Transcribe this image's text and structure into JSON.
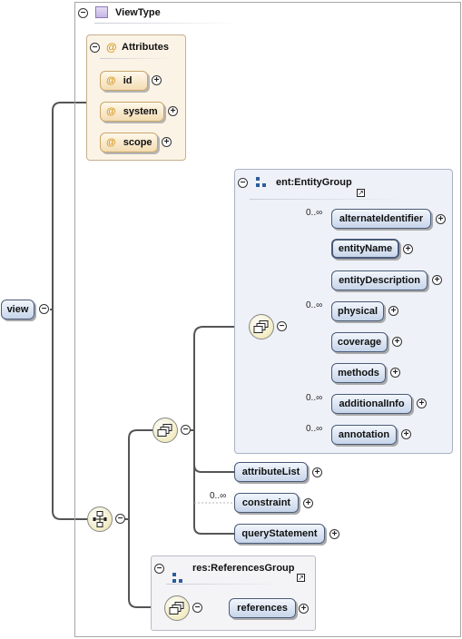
{
  "root": {
    "title": "ViewType",
    "element": "view"
  },
  "attributes": {
    "title": "Attributes",
    "items": [
      "id",
      "system",
      "scope"
    ]
  },
  "entity_group": {
    "title": "ent:EntityGroup",
    "elements": [
      {
        "name": "alternateIdentifier",
        "card": "0..∞"
      },
      {
        "name": "entityName",
        "card": ""
      },
      {
        "name": "entityDescription",
        "card": ""
      },
      {
        "name": "physical",
        "card": "0..∞"
      },
      {
        "name": "coverage",
        "card": ""
      },
      {
        "name": "methods",
        "card": ""
      },
      {
        "name": "additionalInfo",
        "card": "0..∞"
      },
      {
        "name": "annotation",
        "card": "0..∞"
      }
    ]
  },
  "sequence_elements": [
    {
      "name": "attributeList",
      "card": ""
    },
    {
      "name": "constraint",
      "card": "0..∞"
    },
    {
      "name": "queryStatement",
      "card": ""
    }
  ],
  "references_group": {
    "title": "res:ReferencesGroup",
    "element": "references"
  },
  "glyphs": {
    "plus": "+",
    "minus": "−",
    "at": "@",
    "external": "↗"
  }
}
